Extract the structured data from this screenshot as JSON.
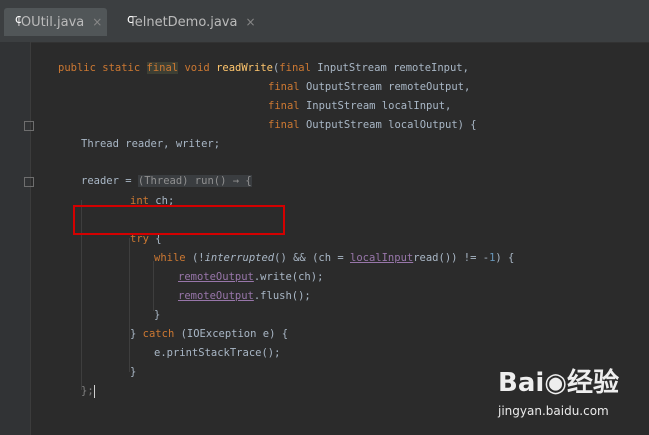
{
  "tabs": [
    {
      "label": "IOUtil.java",
      "close": "×"
    },
    {
      "label": "TelnetDemo.java",
      "close": "×"
    }
  ],
  "code": {
    "l1": {
      "a": "public static ",
      "b": "final",
      "c": " void ",
      "d": "readWrite",
      "e": "(",
      "f": "final ",
      "g": "InputStream remoteInput,"
    },
    "l2": {
      "a": "final ",
      "b": "OutputStream remoteOutput,"
    },
    "l3": {
      "a": "final ",
      "b": "InputStream localInput,"
    },
    "l4": {
      "a": "final ",
      "b": "OutputStream localOutput) {"
    },
    "l5": "Thread reader, writer;",
    "l6": {
      "a": "reader = ",
      "b": "(Thread) run() → {"
    },
    "l7": {
      "a": "int ",
      "b": "ch;"
    },
    "l8": {
      "a": "try ",
      "b": "{"
    },
    "l9": {
      "a": "while ",
      "b": "(!",
      "c": "interrupted",
      "d": "() && (ch = ",
      "e": "localInput",
      ".": ".",
      "f": "read()) != -",
      "g": "1",
      ")": ") {"
    },
    "l10": {
      "a": "remoteOutput",
      "b": ".write(ch);"
    },
    "l11": {
      "a": "remoteOutput",
      "b": ".flush();"
    },
    "l12": "}",
    "l13": {
      "a": "} ",
      "b": "catch ",
      "c": "(IOException e) {"
    },
    "l14": "e.printStackTrace();",
    "l15": "}",
    "l16": "};"
  },
  "watermark": {
    "brand": "Bai◉经验",
    "site": "jingyan.baidu.com"
  },
  "colors": {
    "keyword": "#cc7832",
    "method": "#ffc66d",
    "field": "#9876aa",
    "number": "#6897bb",
    "text": "#a9b7c6",
    "highlight_box": "#d40000"
  }
}
